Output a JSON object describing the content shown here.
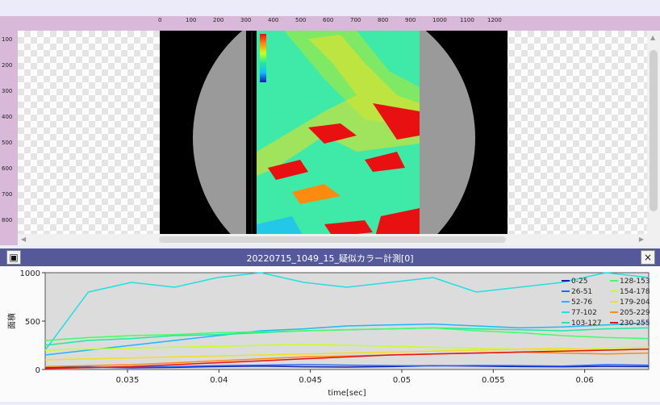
{
  "ruler": {
    "top_ticks": [
      "0",
      "100",
      "200",
      "300",
      "400",
      "500",
      "600",
      "700",
      "800",
      "900",
      "1000",
      "1100",
      "1200"
    ],
    "left_ticks": [
      "100",
      "200",
      "300",
      "400",
      "500",
      "600",
      "700",
      "800"
    ]
  },
  "panel": {
    "title": "20220715_1049_15_疑似カラー計測[0]",
    "close_label": "×"
  },
  "colors": {
    "titlebar": "#55599a",
    "ruler": "#d9b9d9"
  },
  "chart_data": {
    "type": "line",
    "xlabel": "time[sec]",
    "ylabel": "面積",
    "xlim": [
      0.0305,
      0.0635
    ],
    "ylim": [
      0,
      1000
    ],
    "x_ticks": [
      "0.035",
      "0.04",
      "0.045",
      "0.05",
      "0.055",
      "0.06"
    ],
    "y_ticks": [
      "0",
      "500",
      "1000"
    ],
    "legend_position": "top-right",
    "series": [
      {
        "name": "0-25",
        "color": "#0b1fb0",
        "values": [
          20,
          25,
          18,
          22,
          30,
          35,
          28,
          25,
          30,
          40,
          35,
          30,
          28,
          32,
          30
        ]
      },
      {
        "name": "26-51",
        "color": "#2c63ff",
        "values": [
          15,
          20,
          25,
          30,
          40,
          45,
          50,
          45,
          40,
          38,
          42,
          40,
          35,
          50,
          45
        ]
      },
      {
        "name": "52-76",
        "color": "#19b8ff",
        "values": [
          150,
          200,
          250,
          300,
          350,
          400,
          420,
          450,
          460,
          470,
          450,
          430,
          440,
          460,
          480
        ]
      },
      {
        "name": "77-102",
        "color": "#20e0e0",
        "values": [
          200,
          800,
          900,
          850,
          950,
          1000,
          900,
          850,
          900,
          950,
          800,
          850,
          900,
          1000,
          950
        ]
      },
      {
        "name": "103-127",
        "color": "#20e8a0",
        "values": [
          250,
          300,
          320,
          350,
          360,
          380,
          400,
          410,
          420,
          430,
          420,
          410,
          400,
          420,
          430
        ]
      },
      {
        "name": "128-153",
        "color": "#40ff60",
        "values": [
          300,
          330,
          350,
          360,
          380,
          390,
          400,
          410,
          420,
          430,
          400,
          380,
          350,
          330,
          320
        ]
      },
      {
        "name": "154-178",
        "color": "#c8ff20",
        "values": [
          200,
          210,
          220,
          230,
          240,
          250,
          260,
          250,
          240,
          230,
          220,
          210,
          200,
          220,
          230
        ]
      },
      {
        "name": "179-204",
        "color": "#f0e020",
        "values": [
          100,
          110,
          120,
          130,
          140,
          150,
          160,
          170,
          180,
          190,
          200,
          210,
          220,
          200,
          210
        ]
      },
      {
        "name": "205-229",
        "color": "#ff8a10",
        "values": [
          30,
          40,
          50,
          70,
          90,
          110,
          130,
          140,
          150,
          160,
          170,
          180,
          170,
          160,
          170
        ]
      },
      {
        "name": "230-255",
        "color": "#e81010",
        "values": [
          10,
          20,
          30,
          50,
          70,
          90,
          110,
          130,
          150,
          160,
          170,
          180,
          190,
          200,
          210
        ]
      }
    ]
  }
}
